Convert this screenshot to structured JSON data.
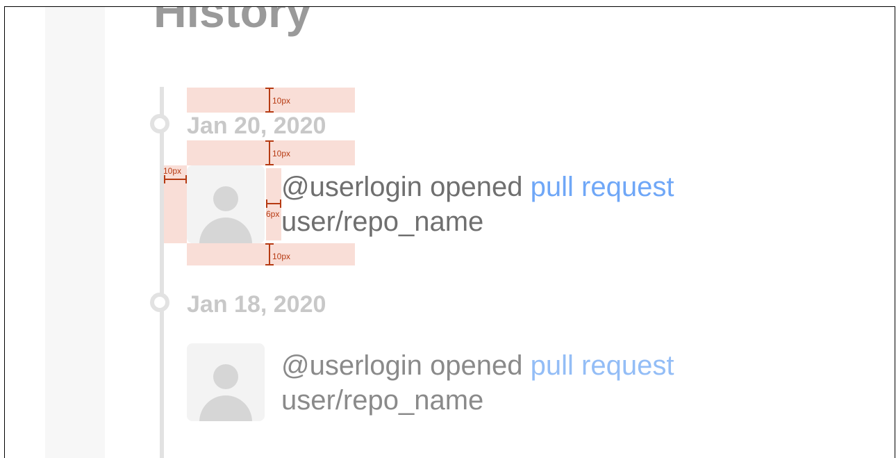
{
  "page": {
    "title": "History"
  },
  "timeline": {
    "entries": [
      {
        "date": "Jan 20, 2020",
        "actor": "@userlogin",
        "verb": "opened",
        "link_text": "pull request",
        "repo": "user/repo_name"
      },
      {
        "date": "Jan 18, 2020",
        "actor": "@userlogin",
        "verb": "opened",
        "link_text": "pull request",
        "repo": "user/repo_name"
      }
    ]
  },
  "annotations": {
    "top_spacing": "10px",
    "mid_spacing": "10px",
    "bottom_spacing": "10px",
    "left_spacing": "10px",
    "avatar_gap": "6px"
  },
  "colors": {
    "title": "#9a9a9a",
    "date": "#c8c8c8",
    "link": "#6fa7f7",
    "timeline": "#e2e2e2",
    "annotation": "#b63a12"
  },
  "icons": {
    "avatar": "avatar-placeholder-icon",
    "timeline_marker": "timeline-marker-icon"
  }
}
